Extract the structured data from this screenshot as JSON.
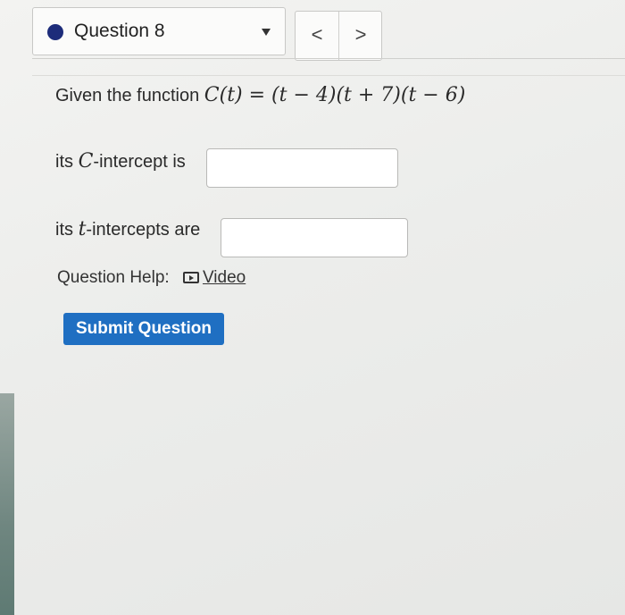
{
  "header": {
    "question_label": "Question 8",
    "prev_label": "<",
    "next_label": ">"
  },
  "problem": {
    "intro": "Given the function",
    "function_expression": "C(t) = (t − 4)(t + 7)(t − 6)"
  },
  "answers": {
    "c_intercept_prefix": "its",
    "c_intercept_var": "C",
    "c_intercept_suffix": "-intercept is",
    "c_intercept_value": "",
    "t_intercepts_prefix": "its",
    "t_intercepts_var": "t",
    "t_intercepts_suffix": "-intercepts are",
    "t_intercepts_value": ""
  },
  "help": {
    "label": "Question Help:",
    "video_label": "Video"
  },
  "submit": {
    "label": "Submit Question"
  },
  "colors": {
    "accent": "#1f6fc2",
    "question_dot": "#1d2c7a"
  }
}
